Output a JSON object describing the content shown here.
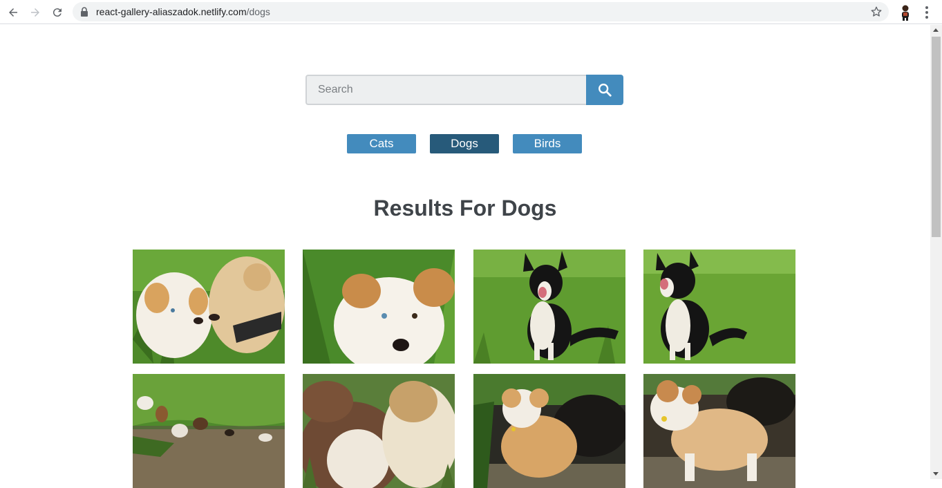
{
  "browser": {
    "url_host": "react-gallery-aliaszadok.netlify.com",
    "url_path": "/dogs",
    "icons": [
      "back-arrow-icon",
      "forward-arrow-icon",
      "reload-icon",
      "lock-icon",
      "star-icon",
      "profile-avatar",
      "menu-dots-icon"
    ]
  },
  "search": {
    "placeholder": "Search",
    "value": ""
  },
  "nav": {
    "items": [
      {
        "label": "Cats",
        "active": false
      },
      {
        "label": "Dogs",
        "active": true
      },
      {
        "label": "Birds",
        "active": false
      }
    ]
  },
  "results": {
    "title": "Results For Dogs"
  },
  "colors": {
    "accent": "#438bbd",
    "accent_active": "#275a7a",
    "title": "#3f4449"
  }
}
